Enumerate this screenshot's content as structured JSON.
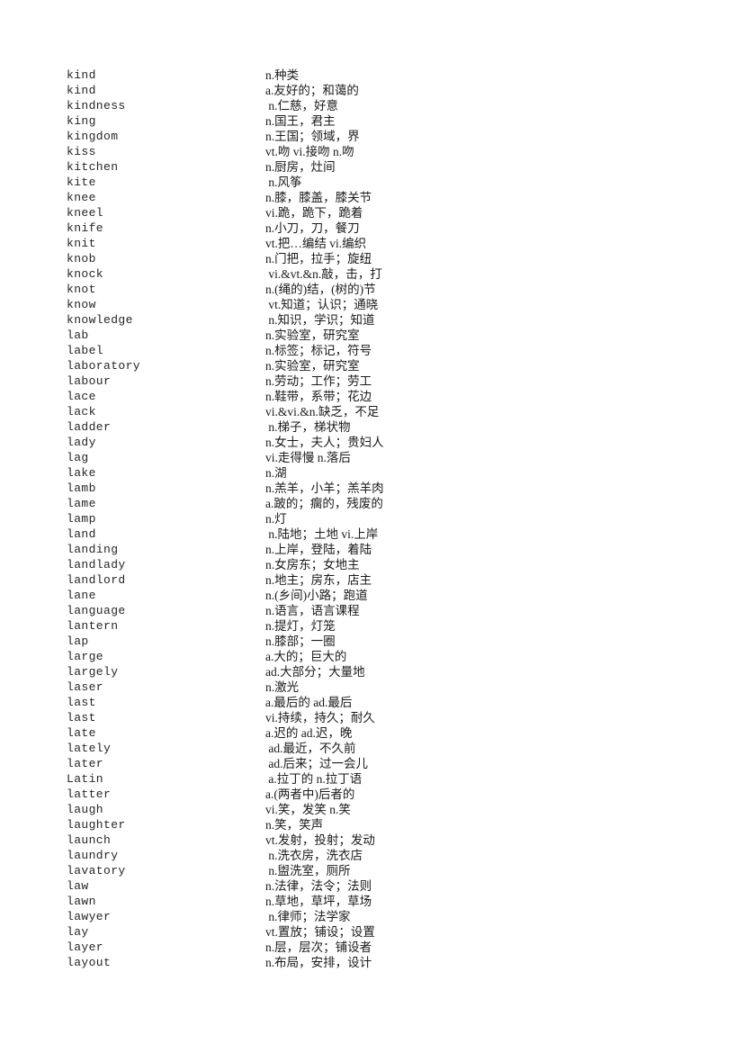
{
  "document": {
    "type": "vocabulary-glossary",
    "language_pair": "English-Chinese",
    "letter_section": "K-L"
  },
  "entries": [
    {
      "term": "kind",
      "definition": "n.种类"
    },
    {
      "term": "kind",
      "definition": "a.友好的；和蔼的"
    },
    {
      "term": "kindness",
      "definition": " n.仁慈，好意"
    },
    {
      "term": "king",
      "definition": "n.国王，君主"
    },
    {
      "term": "kingdom",
      "definition": "n.王国；领域，界"
    },
    {
      "term": "kiss",
      "definition": "vt.吻 vi.接吻 n.吻"
    },
    {
      "term": "kitchen",
      "definition": "n.厨房，灶间"
    },
    {
      "term": "kite",
      "definition": " n.风筝"
    },
    {
      "term": "knee",
      "definition": "n.膝，膝盖，膝关节"
    },
    {
      "term": "kneel",
      "definition": "vi.跪，跪下，跪着"
    },
    {
      "term": "knife",
      "definition": "n.小刀，刀，餐刀"
    },
    {
      "term": "knit",
      "definition": "vt.把…编结 vi.编织"
    },
    {
      "term": "knob",
      "definition": "n.门把，拉手；旋纽"
    },
    {
      "term": "knock",
      "definition": " vi.&vt.&n.敲，击，打"
    },
    {
      "term": "knot",
      "definition": "n.(绳的)结，(树的)节"
    },
    {
      "term": "know",
      "definition": " vt.知道；认识；通晓"
    },
    {
      "term": "knowledge",
      "definition": " n.知识，学识；知道"
    },
    {
      "term": "lab",
      "definition": "n.实验室，研究室"
    },
    {
      "term": "label",
      "definition": "n.标签；标记，符号"
    },
    {
      "term": "laboratory",
      "definition": "n.实验室，研究室"
    },
    {
      "term": "labour",
      "definition": "n.劳动；工作；劳工"
    },
    {
      "term": "lace",
      "definition": "n.鞋带，系带；花边"
    },
    {
      "term": "lack",
      "definition": "vi.&vi.&n.缺乏，不足"
    },
    {
      "term": "ladder",
      "definition": " n.梯子，梯状物"
    },
    {
      "term": "lady",
      "definition": "n.女士，夫人；贵妇人"
    },
    {
      "term": "lag",
      "definition": "vi.走得慢 n.落后"
    },
    {
      "term": "lake",
      "definition": "n.湖"
    },
    {
      "term": "lamb",
      "definition": "n.羔羊，小羊；羔羊肉"
    },
    {
      "term": "lame",
      "definition": "a.跛的；瘸的，残废的"
    },
    {
      "term": "lamp",
      "definition": "n.灯"
    },
    {
      "term": "land",
      "definition": " n.陆地；土地 vi.上岸"
    },
    {
      "term": "landing",
      "definition": "n.上岸，登陆，着陆"
    },
    {
      "term": "landlady",
      "definition": "n.女房东；女地主"
    },
    {
      "term": "landlord",
      "definition": "n.地主；房东，店主"
    },
    {
      "term": "lane",
      "definition": "n.(乡间)小路；跑道"
    },
    {
      "term": "language",
      "definition": "n.语言，语言课程"
    },
    {
      "term": "lantern",
      "definition": "n.提灯，灯笼"
    },
    {
      "term": "lap",
      "definition": "n.膝部；一圈"
    },
    {
      "term": "large",
      "definition": "a.大的；巨大的"
    },
    {
      "term": "largely",
      "definition": "ad.大部分；大量地"
    },
    {
      "term": "laser",
      "definition": "n.激光"
    },
    {
      "term": "last",
      "definition": "a.最后的 ad.最后"
    },
    {
      "term": "last",
      "definition": "vi.持续，持久；耐久"
    },
    {
      "term": "late",
      "definition": "a.迟的 ad.迟，晚"
    },
    {
      "term": "lately",
      "definition": " ad.最近，不久前"
    },
    {
      "term": "later",
      "definition": " ad.后来；过一会儿"
    },
    {
      "term": "Latin",
      "definition": " a.拉丁的 n.拉丁语"
    },
    {
      "term": "latter",
      "definition": "a.(两者中)后者的"
    },
    {
      "term": "laugh",
      "definition": "vi.笑，发笑 n.笑"
    },
    {
      "term": "laughter",
      "definition": "n.笑，笑声"
    },
    {
      "term": "launch",
      "definition": "vt.发射，投射；发动"
    },
    {
      "term": "laundry",
      "definition": " n.洗衣房，洗衣店"
    },
    {
      "term": "lavatory",
      "definition": " n.盥洗室，厕所"
    },
    {
      "term": "law",
      "definition": "n.法律，法令；法则"
    },
    {
      "term": "lawn",
      "definition": "n.草地，草坪，草场"
    },
    {
      "term": "lawyer",
      "definition": " n.律师；法学家"
    },
    {
      "term": "lay",
      "definition": "vt.置放；铺设；设置"
    },
    {
      "term": "layer",
      "definition": "n.层，层次；铺设者"
    },
    {
      "term": "layout",
      "definition": "n.布局，安排，设计"
    }
  ]
}
